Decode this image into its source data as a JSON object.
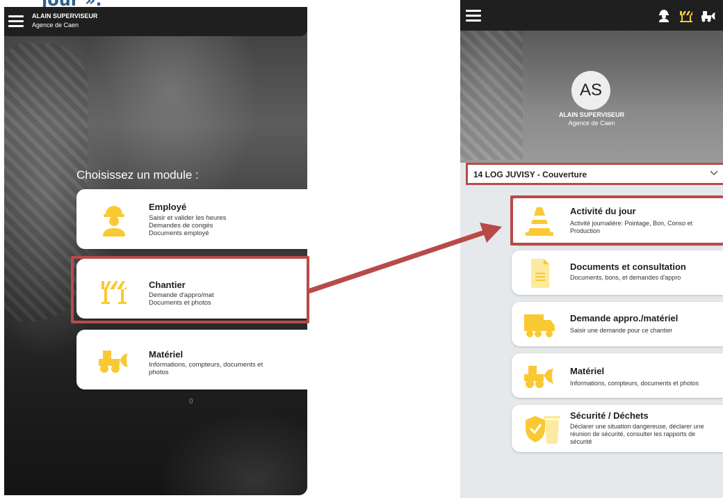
{
  "doc": {
    "heading": "jour »."
  },
  "left_screen": {
    "user": {
      "name": "ALAIN SUPERVISEUR",
      "agency": "Agence de Caen"
    },
    "choose_title": "Choisissez un module :",
    "modules": [
      {
        "title": "Employé",
        "lines": [
          "Saisir et valider les heures",
          "Demandes de congés",
          "Documents employé"
        ],
        "icon": "worker-icon"
      },
      {
        "title": "Chantier",
        "lines": [
          "Demande d'appro/mat",
          "Documents et photos"
        ],
        "icon": "barrier-icon"
      },
      {
        "title": "Matériel",
        "lines": [
          "Informations, compteurs, documents et",
          "photos"
        ],
        "icon": "loader-icon"
      }
    ],
    "footer_char": "0"
  },
  "right_screen": {
    "user": {
      "initials": "AS",
      "name": "ALAIN SUPERVISEUR",
      "agency": "Agence de Caen"
    },
    "site_select": {
      "value": "14 LOG JUVISY - Couverture"
    },
    "activities": [
      {
        "title": "Activité du jour",
        "lines": [
          "Activité journalière: Pointage, Bon, Conso et",
          "Production"
        ],
        "icon": "traffic-cone-icon"
      },
      {
        "title": "Documents et consultation",
        "lines": [
          "Documents, bons, et demandes d'appro"
        ],
        "icon": "document-icon"
      },
      {
        "title": "Demande appro./matériel",
        "lines": [
          "Saisir une demande pour ce chantier"
        ],
        "icon": "truck-icon"
      },
      {
        "title": "Matériel",
        "lines": [
          "Informations, compteurs, documents et photos"
        ],
        "icon": "loader-icon"
      },
      {
        "title": "Sécurité / Déchets",
        "lines": [
          "Déclarer une situation dangereuse, déclarer une",
          "réunion de sécurité, consulter les rapports de",
          "sécurité"
        ],
        "icon": "shield-bin-icon"
      }
    ]
  },
  "colors": {
    "accent_yellow": "#f9c934",
    "highlight_red": "#b94a48",
    "heading_blue": "#2e5e8e",
    "topbar": "#1f1f1f"
  }
}
